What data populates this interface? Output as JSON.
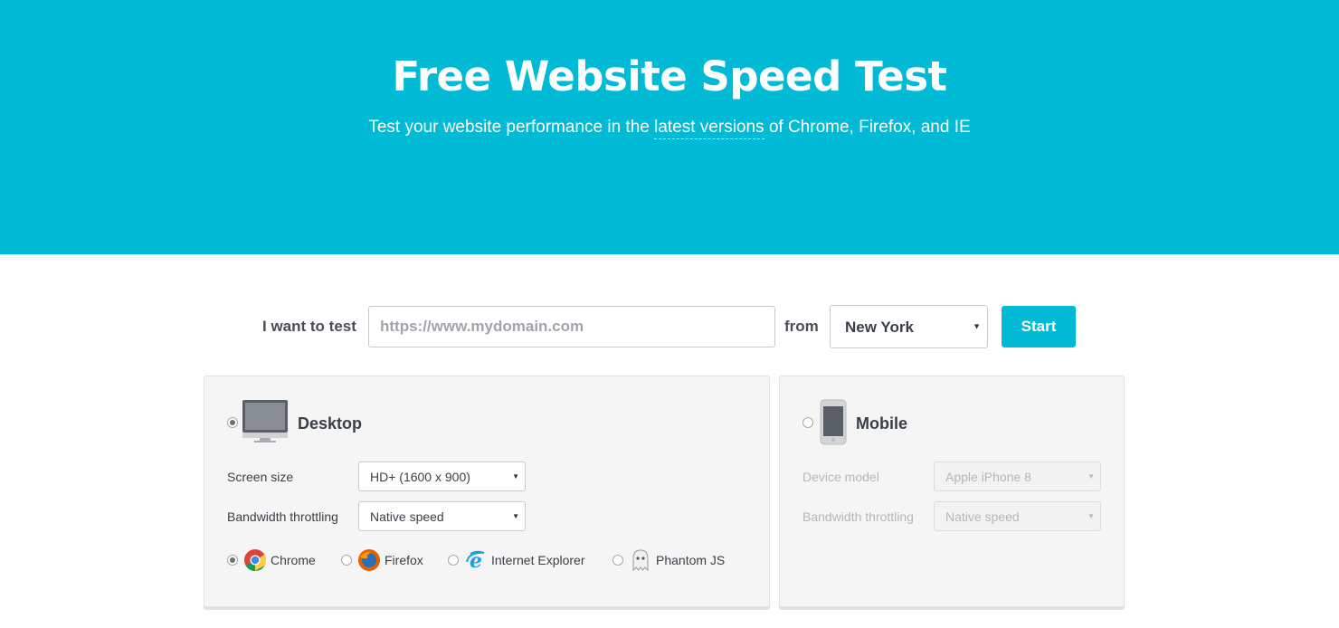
{
  "hero": {
    "title": "Free Website Speed Test",
    "subtitle_before": "Test your website performance in the ",
    "subtitle_link": "latest versions",
    "subtitle_after": " of Chrome, Firefox, and IE"
  },
  "test_form": {
    "want_label": "I want to test",
    "url_value": "",
    "url_placeholder": "https://www.mydomain.com",
    "from_label": "from",
    "location_value": "New York",
    "start_label": "Start"
  },
  "desktop": {
    "label": "Desktop",
    "selected": true,
    "screen_size_label": "Screen size",
    "screen_size_value": "HD+ (1600 x 900)",
    "bandwidth_label": "Bandwidth throttling",
    "bandwidth_value": "Native speed",
    "browsers": [
      {
        "label": "Chrome",
        "icon": "chrome-icon",
        "selected": true
      },
      {
        "label": "Firefox",
        "icon": "firefox-icon",
        "selected": false
      },
      {
        "label": "Internet Explorer",
        "icon": "internet-explorer-icon",
        "selected": false
      },
      {
        "label": "Phantom JS",
        "icon": "phantomjs-ghost-icon",
        "selected": false
      }
    ]
  },
  "mobile": {
    "label": "Mobile",
    "selected": false,
    "device_label": "Device model",
    "device_value": "Apple iPhone 8",
    "bandwidth_label": "Bandwidth throttling",
    "bandwidth_value": "Native speed"
  },
  "colors": {
    "brand": "#00bad6",
    "panel_bg": "#f5f5f5",
    "text": "#3a3f47"
  }
}
